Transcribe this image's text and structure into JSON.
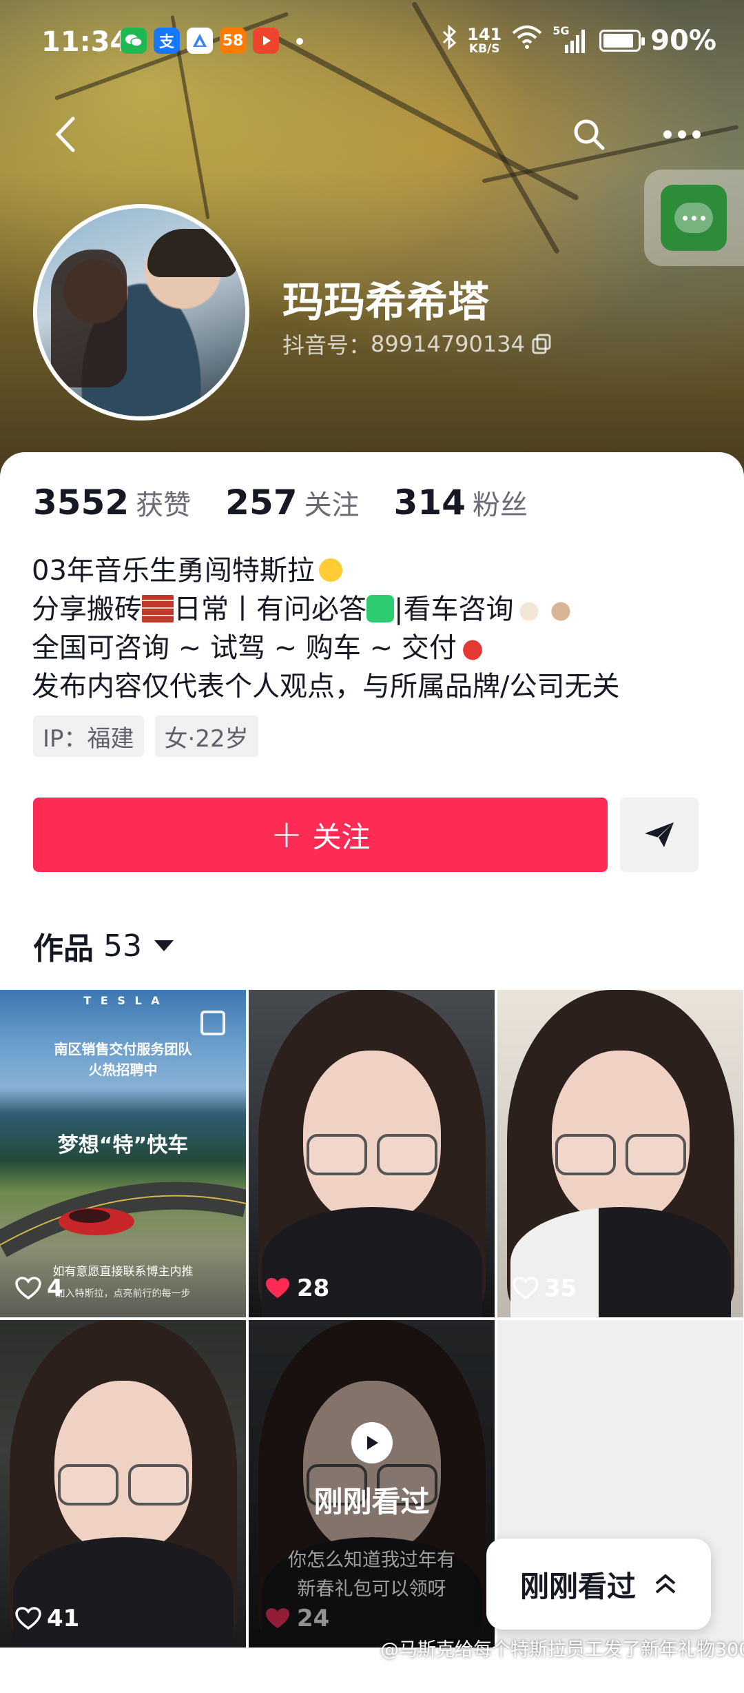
{
  "status_bar": {
    "time": "11:34",
    "net_speed_value": "141",
    "net_speed_unit": "KB/S",
    "network": "5G",
    "battery": "90%",
    "battery_level": 0.9,
    "app_icons": [
      {
        "icon": "wechat-icon",
        "color": "#1fb954",
        "glyph": ""
      },
      {
        "icon": "alipay-icon",
        "color": "#1677ff",
        "glyph": "支"
      },
      {
        "icon": "app-a-icon",
        "color": "#3b82f6",
        "glyph": ""
      },
      {
        "icon": "58-app-icon",
        "color": "#ff7a00",
        "glyph": "58"
      },
      {
        "icon": "video-app-icon",
        "color": "#f0452d",
        "glyph": ""
      }
    ]
  },
  "profile": {
    "display_name": "玛玛希希塔",
    "douyin_id_label": "抖音号：",
    "douyin_id": "89914790134",
    "stats": [
      {
        "value": "3552",
        "label": "获赞"
      },
      {
        "value": "257",
        "label": "关注"
      },
      {
        "value": "314",
        "label": "粉丝"
      }
    ],
    "bio_lines": [
      "03年音乐生勇闯特斯拉",
      "分享搬砖",
      "日常丨有问必答",
      "|看车咨询",
      "全国可咨询 ~ 试驾 ~ 购车 ~ 交付",
      "发布内容仅代表个人观点，与所属品牌/公司无关"
    ],
    "tags": [
      "IP：福建",
      "女·22岁"
    ]
  },
  "actions": {
    "follow_label": "关注",
    "follow_plus": "+"
  },
  "works_tab": {
    "label": "作品",
    "count": "53"
  },
  "videos": [
    {
      "likes": "4",
      "liked": false,
      "brand": "T E S L A",
      "line1": "南区销售交付服务团队",
      "line2": "火热招聘中",
      "headline": "梦想“特”快车",
      "footer1": "如有意愿直接联系博主内推",
      "footer2": "加入特斯拉，点亮前行的每一步"
    },
    {
      "likes": "28",
      "liked": true
    },
    {
      "likes": "35",
      "liked": false
    },
    {
      "likes": "41",
      "liked": false
    },
    {
      "likes": "24",
      "liked": true,
      "overlay_label": "刚刚看过",
      "caption1": "你怎么知道我过年有",
      "caption2": "新春礼包可以领呀"
    }
  ],
  "recently_viewed_button": "刚刚看过",
  "ticker_text": "@马斯克给每个特斯拉员工发了新年礼物300..."
}
